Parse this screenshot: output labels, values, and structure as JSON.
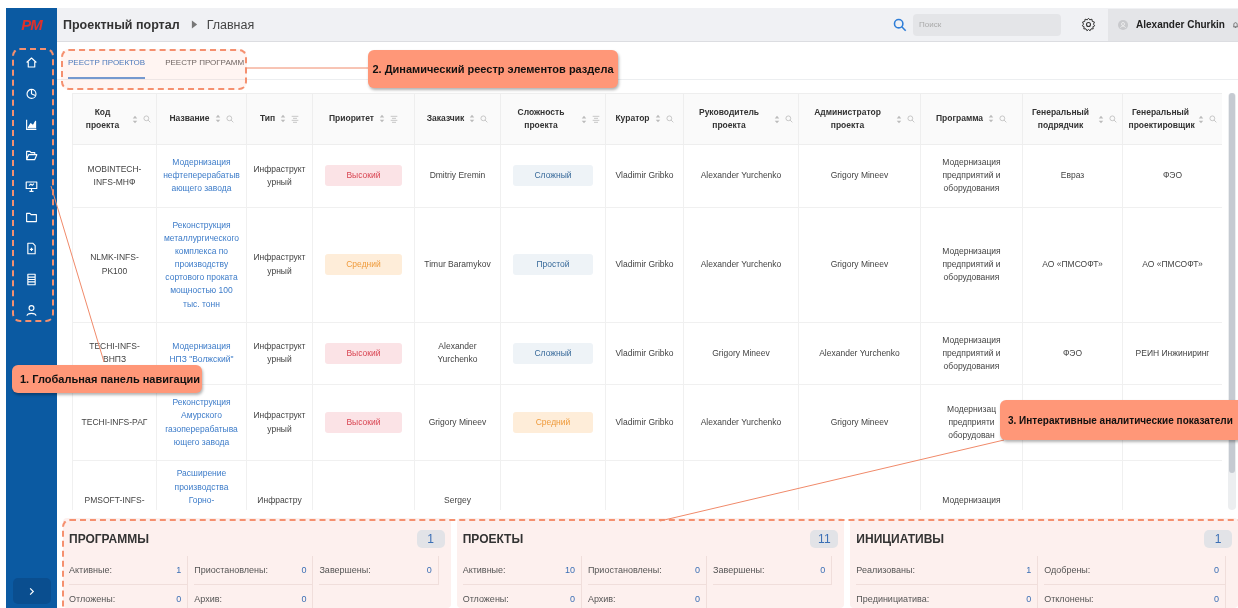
{
  "sidebar": {
    "logo": "PM"
  },
  "header": {
    "title": "Проектный портал",
    "page": "Главная",
    "search": {
      "placeholder": "Поиск"
    },
    "user": "Alexander Churkin"
  },
  "tabs": [
    {
      "label": "РЕЕСТР ПРОЕКТОВ",
      "selected": true
    },
    {
      "label": "РЕЕСТР ПРОГРАММ",
      "selected": false
    }
  ],
  "table": {
    "columns": [
      {
        "label": "Код проекта"
      },
      {
        "label": "Название"
      },
      {
        "label": "Тип"
      },
      {
        "label": "Приоритет"
      },
      {
        "label": "Заказчик"
      },
      {
        "label": "Сложность проекта"
      },
      {
        "label": "Куратор"
      },
      {
        "label": "Руководитель проекта"
      },
      {
        "label": "Администратор проекта"
      },
      {
        "label": "Программа"
      },
      {
        "label": "Генеральный подрядчик"
      },
      {
        "label": "Генеральный проектировщик"
      }
    ],
    "rows": [
      {
        "cells": [
          {
            "text": "MOBINTECH-INFS-МНФ"
          },
          {
            "text": "Модернизация нефтеперерабатывающего завода",
            "kind": "link"
          },
          {
            "text": "Инфраструктурный"
          },
          {
            "text": "Высокий",
            "kind": "high"
          },
          {
            "text": "Dmitriy Eremin"
          },
          {
            "text": "Сложный",
            "kind": "neutral"
          },
          {
            "text": "Vladimir Gribko"
          },
          {
            "text": "Alexander Yurchenko"
          },
          {
            "text": "Grigory Mineev"
          },
          {
            "text": "Модернизация предприятий и оборудования"
          },
          {
            "text": "Евраз"
          },
          {
            "text": "ФЭО"
          }
        ]
      },
      {
        "cells": [
          {
            "text": "NLMK-INFS-PK100"
          },
          {
            "text": "Реконструкция металлургического комплекса по производству сортового проката мощностью 100 тыс. тонн",
            "kind": "link"
          },
          {
            "text": "Инфраструктурный"
          },
          {
            "text": "Средний",
            "kind": "medium"
          },
          {
            "text": "Timur Baramykov"
          },
          {
            "text": "Простой",
            "kind": "neutral"
          },
          {
            "text": "Vladimir Gribko"
          },
          {
            "text": "Alexander Yurchenko"
          },
          {
            "text": "Grigory Mineev"
          },
          {
            "text": "Модернизация предприятий и оборудования"
          },
          {
            "text": "АО «ПМСОФТ»"
          },
          {
            "text": "АО «ПМСОФТ»"
          }
        ]
      },
      {
        "cells": [
          {
            "text": "TECHI-INFS-ВНПЗ"
          },
          {
            "text": "Модернизация НПЗ \"Волжский\"",
            "kind": "link"
          },
          {
            "text": "Инфраструктурный"
          },
          {
            "text": "Высокий",
            "kind": "high"
          },
          {
            "text": "Alexander Yurchenko"
          },
          {
            "text": "Сложный",
            "kind": "neutral"
          },
          {
            "text": "Vladimir Gribko"
          },
          {
            "text": "Grigory Mineev"
          },
          {
            "text": "Alexander Yurchenko"
          },
          {
            "text": "Модернизация предприятий и оборудования"
          },
          {
            "text": "ФЭО"
          },
          {
            "text": "РЕИН Инжиниринг"
          }
        ]
      },
      {
        "cells": [
          {
            "text": "TECHI-INFS-РАГ"
          },
          {
            "text": "Реконструкция Амурского газоперерабатывающего завода",
            "kind": "link"
          },
          {
            "text": "Инфраструктурный"
          },
          {
            "text": "Высокий",
            "kind": "high"
          },
          {
            "text": "Grigory Mineev"
          },
          {
            "text": "Средний",
            "kind": "medium"
          },
          {
            "text": "Vladimir Gribko"
          },
          {
            "text": "Alexander Yurchenko"
          },
          {
            "text": "Grigory Mineev"
          },
          {
            "text": "Модернизац\nпредприяти\nоборудован"
          },
          {},
          {}
        ]
      },
      {
        "cells": [
          {
            "text": "PMSOFT-INFS-"
          },
          {
            "text": "Расширение производства Горно-",
            "kind": "link"
          },
          {
            "text": "Инфрастру"
          },
          {},
          {
            "text": "Sergey"
          },
          {},
          {},
          {},
          {},
          {
            "text": "Модернизация"
          },
          {},
          {}
        ]
      }
    ]
  },
  "stats": [
    {
      "title": "ПРОГРАММЫ",
      "count": "1",
      "items": [
        {
          "label": "Активные:",
          "value": "1"
        },
        {
          "label": "Приостановлены:",
          "value": "0"
        },
        {
          "label": "Завершены:",
          "value": "0"
        },
        {
          "label": "Отложены:",
          "value": "0"
        },
        {
          "label": "Архив:",
          "value": "0"
        }
      ]
    },
    {
      "title": "ПРОЕКТЫ",
      "count": "11",
      "items": [
        {
          "label": "Активные:",
          "value": "10"
        },
        {
          "label": "Приостановлены:",
          "value": "0"
        },
        {
          "label": "Завершены:",
          "value": "0"
        },
        {
          "label": "Отложены:",
          "value": "0"
        },
        {
          "label": "Архив:",
          "value": "0"
        }
      ]
    },
    {
      "title": "ИНИЦИАТИВЫ",
      "count": "1",
      "items": [
        {
          "label": "Реализованы:",
          "value": "1"
        },
        {
          "label": "Одобрены:",
          "value": "0"
        },
        {
          "label": "Прединициатива:",
          "value": "0"
        },
        {
          "label": "Отклонены:",
          "value": "0"
        }
      ]
    }
  ],
  "annotations": [
    {
      "text": "1. Глобальная панель навигации"
    },
    {
      "text": "2. Динамический реестр элементов раздела"
    },
    {
      "text": "3. Интерактивные аналитические показатели"
    }
  ]
}
